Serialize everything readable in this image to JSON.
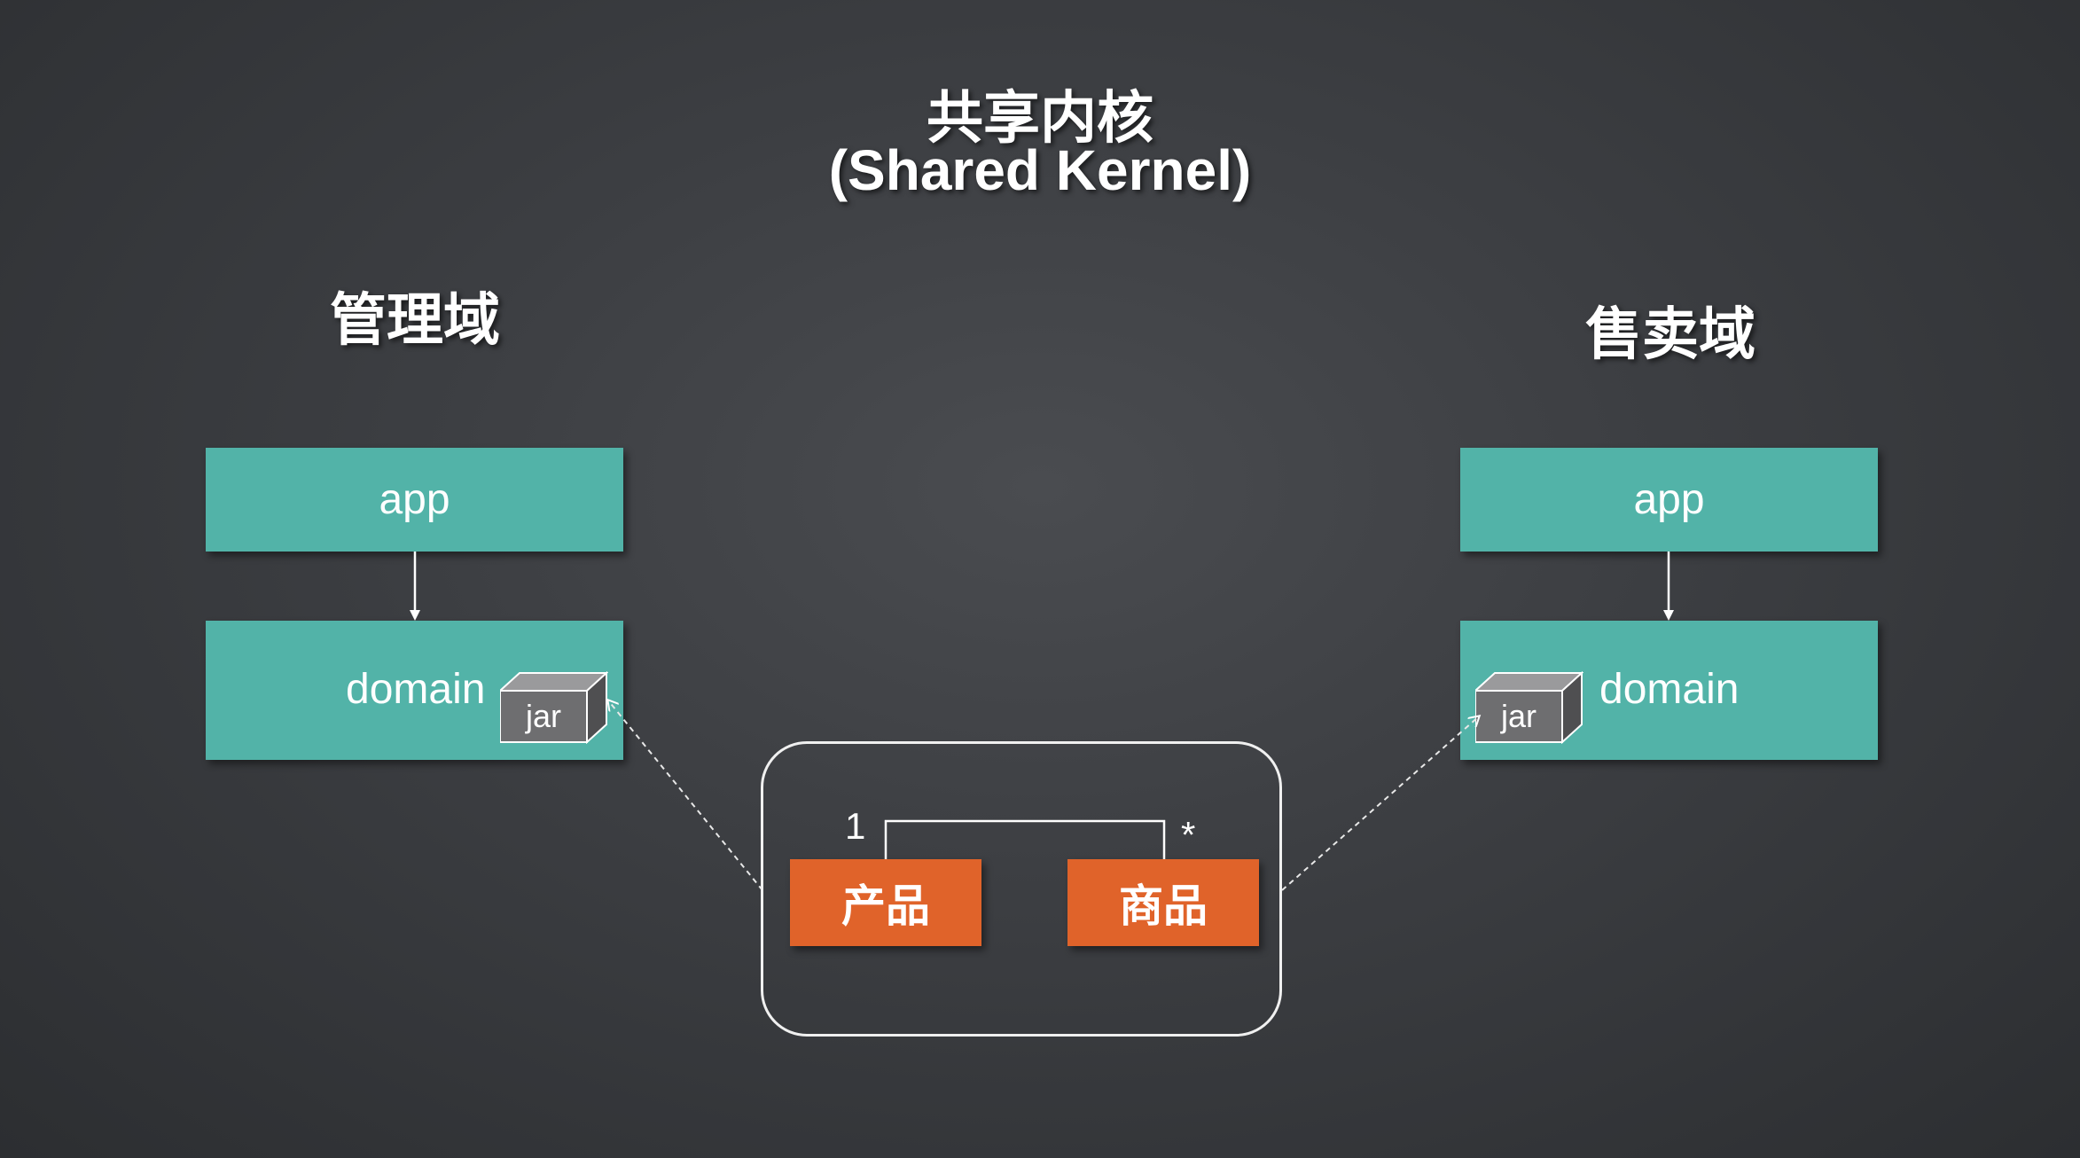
{
  "title": {
    "line1": "共享内核",
    "line2": "(Shared Kernel)"
  },
  "left_context": {
    "title": "管理域",
    "app_label": "app",
    "domain_label": "domain",
    "jar_label": "jar"
  },
  "right_context": {
    "title": "售卖域",
    "app_label": "app",
    "domain_label": "domain",
    "jar_label": "jar"
  },
  "shared_kernel": {
    "entities": {
      "product": "产品",
      "goods": "商品"
    },
    "multiplicity": {
      "product_side": "1",
      "goods_side": "*"
    }
  },
  "colors": {
    "background": "#3d3f43",
    "layer_box": "#52b3a8",
    "entity_box": "#e0632a",
    "jar_front": "#6e6e70",
    "line": "#ffffff"
  }
}
